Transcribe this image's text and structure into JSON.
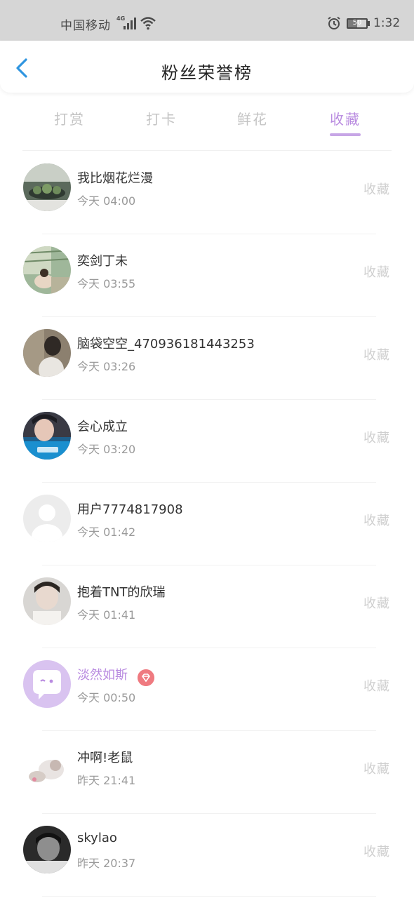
{
  "status_bar": {
    "carrier": "中国移动",
    "network": "4G",
    "time": "1:32",
    "battery": "50",
    "battery_level": 0.5
  },
  "header": {
    "title": "粉丝荣誉榜",
    "back_icon": "chevron-left-icon"
  },
  "tabs": [
    {
      "label": "打赏",
      "active": false
    },
    {
      "label": "打卡",
      "active": false
    },
    {
      "label": "鲜花",
      "active": false
    },
    {
      "label": "收藏",
      "active": true
    }
  ],
  "colors": {
    "accent": "#b98be0",
    "back": "#2f95e0",
    "badge": "#ef7a80"
  },
  "fans": [
    {
      "name": "我比烟花烂漫",
      "time": "今天 04:00",
      "action": "收藏",
      "vip": false
    },
    {
      "name": "奕剑丁未",
      "time": "今天 03:55",
      "action": "收藏",
      "vip": false
    },
    {
      "name": "脑袋空空_470936181443253",
      "time": "今天 03:26",
      "action": "收藏",
      "vip": false
    },
    {
      "name": "会心成立",
      "time": "今天 03:20",
      "action": "收藏",
      "vip": false
    },
    {
      "name": "用户7774817908",
      "time": "今天 01:42",
      "action": "收藏",
      "vip": false
    },
    {
      "name": "抱着TNT的欣瑞",
      "time": "今天 01:41",
      "action": "收藏",
      "vip": false
    },
    {
      "name": "淡然如斯",
      "time": "今天 00:50",
      "action": "收藏",
      "vip": true
    },
    {
      "name": "冲啊!老鼠",
      "time": "昨天 21:41",
      "action": "收藏",
      "vip": false
    },
    {
      "name": "skylao",
      "time": "昨天 20:37",
      "action": "收藏",
      "vip": false
    }
  ]
}
